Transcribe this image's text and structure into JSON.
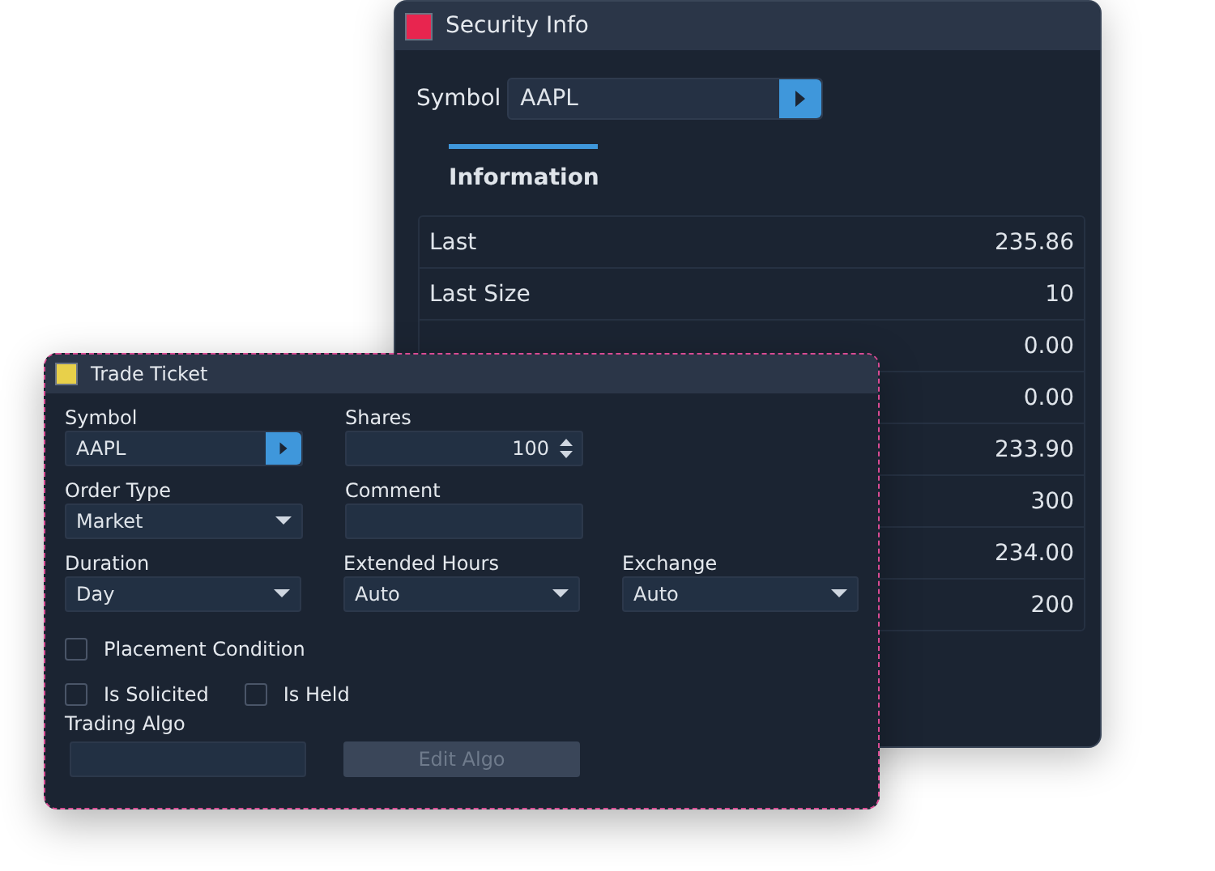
{
  "security": {
    "title": "Security Info",
    "color": "#e8254f",
    "symbol_label": "Symbol",
    "symbol_value": "AAPL",
    "tabs": [
      {
        "label": "Information",
        "selected": true
      }
    ],
    "rows": [
      {
        "label": "Last",
        "value": "235.86"
      },
      {
        "label": "Last Size",
        "value": "10"
      },
      {
        "value": "0.00"
      },
      {
        "value": "0.00"
      },
      {
        "value": "233.90"
      },
      {
        "value": "300"
      },
      {
        "value": "234.00"
      },
      {
        "value": "200"
      }
    ]
  },
  "ticket": {
    "title": "Trade Ticket",
    "color": "#e8d04a",
    "field_rows": [
      [
        {
          "label": "Symbol",
          "kind": "symbol",
          "value": "AAPL"
        },
        {
          "label": "Shares",
          "kind": "spinner",
          "value": "100"
        }
      ],
      [
        {
          "label": "Order Type",
          "kind": "dropdown",
          "value": "Market"
        },
        {
          "label": "Comment",
          "kind": "text"
        }
      ],
      [
        {
          "label": "Duration",
          "kind": "dropdown",
          "value": "Day"
        },
        {
          "label": "Extended Hours",
          "kind": "dropdown",
          "value": "Auto"
        },
        {
          "label": "Exchange",
          "kind": "dropdown",
          "value": "Auto"
        }
      ]
    ],
    "checkbox_rows": [
      [
        {
          "label": "Placement Condition",
          "checked": false
        }
      ],
      [
        {
          "label": "Is Solicited",
          "checked": false
        },
        {
          "label": "Is Held",
          "checked": false
        }
      ]
    ],
    "algo": {
      "label": "Trading Algo",
      "button": {
        "label": "Edit Algo",
        "disabled": true
      }
    }
  }
}
